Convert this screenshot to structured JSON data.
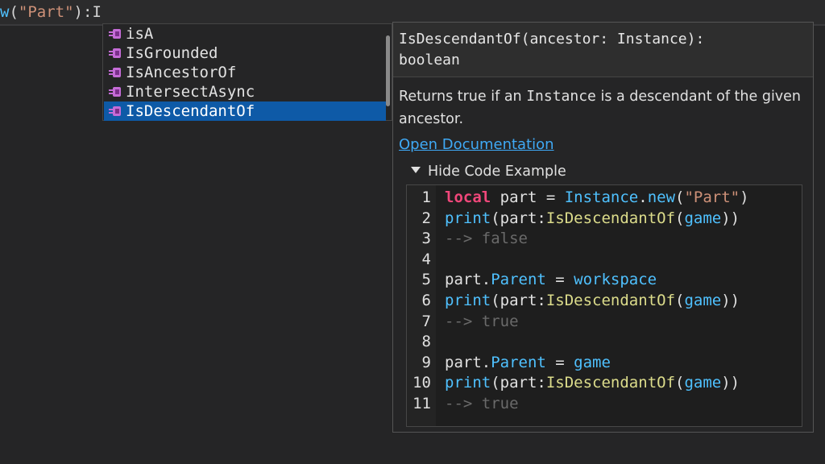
{
  "editor": {
    "line_prefix": "w",
    "line_open": "(",
    "line_string": "\"Part\"",
    "line_close": "):",
    "line_typed": "I"
  },
  "autocomplete": {
    "items": [
      {
        "label": "isA",
        "selected": false
      },
      {
        "label": "IsGrounded",
        "selected": false
      },
      {
        "label": "IsAncestorOf",
        "selected": false
      },
      {
        "label": "IntersectAsync",
        "selected": false
      },
      {
        "label": "IsDescendantOf",
        "selected": true
      }
    ],
    "icon": "method-icon",
    "icon_color": "#c46bd6"
  },
  "docs": {
    "signature_line1": "IsDescendantOf(ancestor: Instance):",
    "signature_line2": "boolean",
    "desc_before": "Returns true if an ",
    "desc_code": "Instance",
    "desc_after": " is a descendant of the given ancestor.",
    "link_label": "Open Documentation",
    "toggle_label": "Hide Code Example"
  },
  "code_example": {
    "line_numbers": [
      "1",
      "2",
      "3",
      "4",
      "5",
      "6",
      "7",
      "8",
      "9",
      "10",
      "11"
    ],
    "l1_kw": "local",
    "l1_rest": " part = ",
    "l1_cls": "Instance",
    "l1_dot": ".",
    "l1_fn": "new",
    "l1_open": "(",
    "l1_str": "\"Part\"",
    "l1_close": ")",
    "print": "print",
    "open": "(",
    "part_colon": "part:",
    "method": "IsDescendantOf",
    "game": "game",
    "close2": "))",
    "comment_false": "--> false",
    "comment_true": "--> true",
    "part_dot": "part.",
    "parent": "Parent",
    "assign": " = ",
    "workspace": "workspace"
  }
}
